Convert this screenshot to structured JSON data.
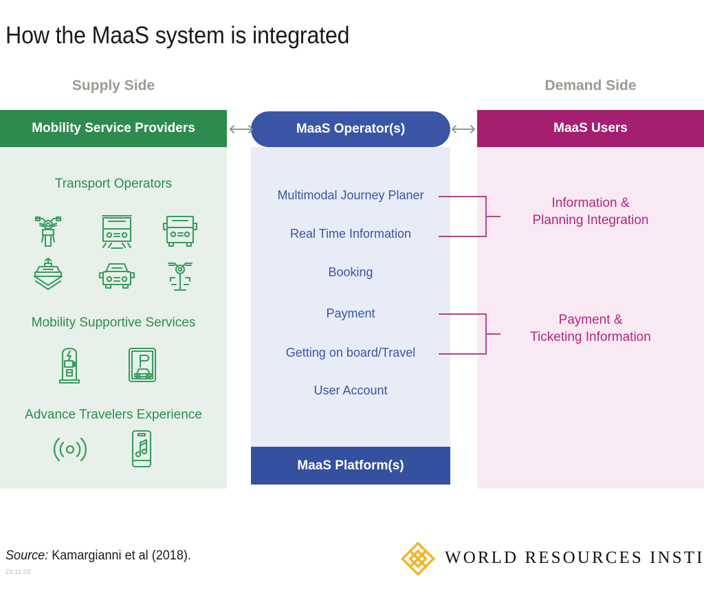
{
  "title": "How the MaaS system is integrated",
  "captions": {
    "supply": "Supply Side",
    "demand": "Demand Side"
  },
  "colors": {
    "green_header": "#2e8b50",
    "green_body": "#e7f1ea",
    "blue_header": "#3a55a5",
    "blue_body": "#e8ecf7",
    "blue_footer": "#33519f",
    "pink_header": "#a51f71",
    "pink_body": "#f8e9f2",
    "pink_line": "#b4458c",
    "caption_gray": "#9b9b93",
    "logo_gold": "#f5b324"
  },
  "supply": {
    "header": "Mobility Service Providers",
    "groups": [
      {
        "title": "Transport Operators",
        "icons": [
          {
            "name": "motorcycle-icon",
            "label": "Motorcycle"
          },
          {
            "name": "train-icon",
            "label": "Train"
          },
          {
            "name": "bus-icon",
            "label": "Bus"
          },
          {
            "name": "ferry-icon",
            "label": "Ferry"
          },
          {
            "name": "car-icon",
            "label": "Car"
          },
          {
            "name": "bicycle-icon",
            "label": "Bicycle"
          }
        ]
      },
      {
        "title": "Mobility Supportive Services",
        "icons": [
          {
            "name": "ev-charging-station-icon",
            "label": "EV charging station"
          },
          {
            "name": "parking-sign-icon",
            "label": "Parking"
          }
        ]
      },
      {
        "title": "Advance Travelers Experience",
        "icons": [
          {
            "name": "wireless-signal-icon",
            "label": "Wireless signal"
          },
          {
            "name": "phone-music-icon",
            "label": "Phone with music"
          }
        ]
      }
    ]
  },
  "operator": {
    "header": "MaaS Operator(s)",
    "footer": "MaaS Platform(s)",
    "functions": [
      "Multimodal Journey Planer",
      "Real Time Information",
      "Booking",
      "Payment",
      "Getting on board/Travel",
      "User Account"
    ]
  },
  "demand": {
    "header": "MaaS Users",
    "groups": [
      {
        "line1": "Information &",
        "line2": "Planning Integration"
      },
      {
        "line1": "Payment &",
        "line2": "Ticketing Information"
      }
    ]
  },
  "connectors": {
    "left_arrow": "double-headed-arrow",
    "right_arrow": "double-headed-arrow"
  },
  "footer": {
    "source_label": "Source:",
    "source_text": "Kamargianni et al (2018).",
    "date_code": "23.11.02",
    "logo_wordmark": "WORLD RESOURCES INSTITUTE"
  }
}
